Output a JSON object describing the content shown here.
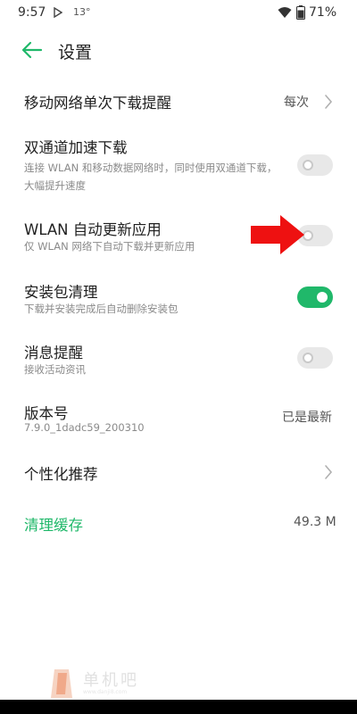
{
  "status_bar": {
    "time": "9:57",
    "temperature": "13°",
    "battery_percent": "71%"
  },
  "header": {
    "title": "设置",
    "back_icon": "arrow-left-icon"
  },
  "settings": {
    "mobile_download_prompt": {
      "title": "移动网络单次下载提醒",
      "value": "每次"
    },
    "dual_channel": {
      "title": "双通道加速下载",
      "subtitle": "连接 WLAN 和移动数据网络时，同时使用双通道下载，大幅提升速度",
      "enabled": false
    },
    "wlan_auto_update": {
      "title": "WLAN 自动更新应用",
      "subtitle": "仅 WLAN 网络下自动下载并更新应用",
      "enabled": false
    },
    "package_cleanup": {
      "title": "安装包清理",
      "subtitle": "下载并安装完成后自动删除安装包",
      "enabled": true
    },
    "notifications": {
      "title": "消息提醒",
      "subtitle": "接收活动资讯",
      "enabled": false
    },
    "version": {
      "title": "版本号",
      "subtitle": "7.9.0_1dadc59_200310",
      "value": "已是最新"
    },
    "personalized": {
      "title": "个性化推荐"
    },
    "clear_cache": {
      "title": "清理缓存",
      "value": "49.3 M"
    }
  },
  "watermark": {
    "text": "单机吧",
    "sub": "www.danji8.com"
  },
  "colors": {
    "accent": "#20b86a",
    "toggle_off": "#e8e8e8",
    "annotation_arrow": "#ee1111"
  }
}
